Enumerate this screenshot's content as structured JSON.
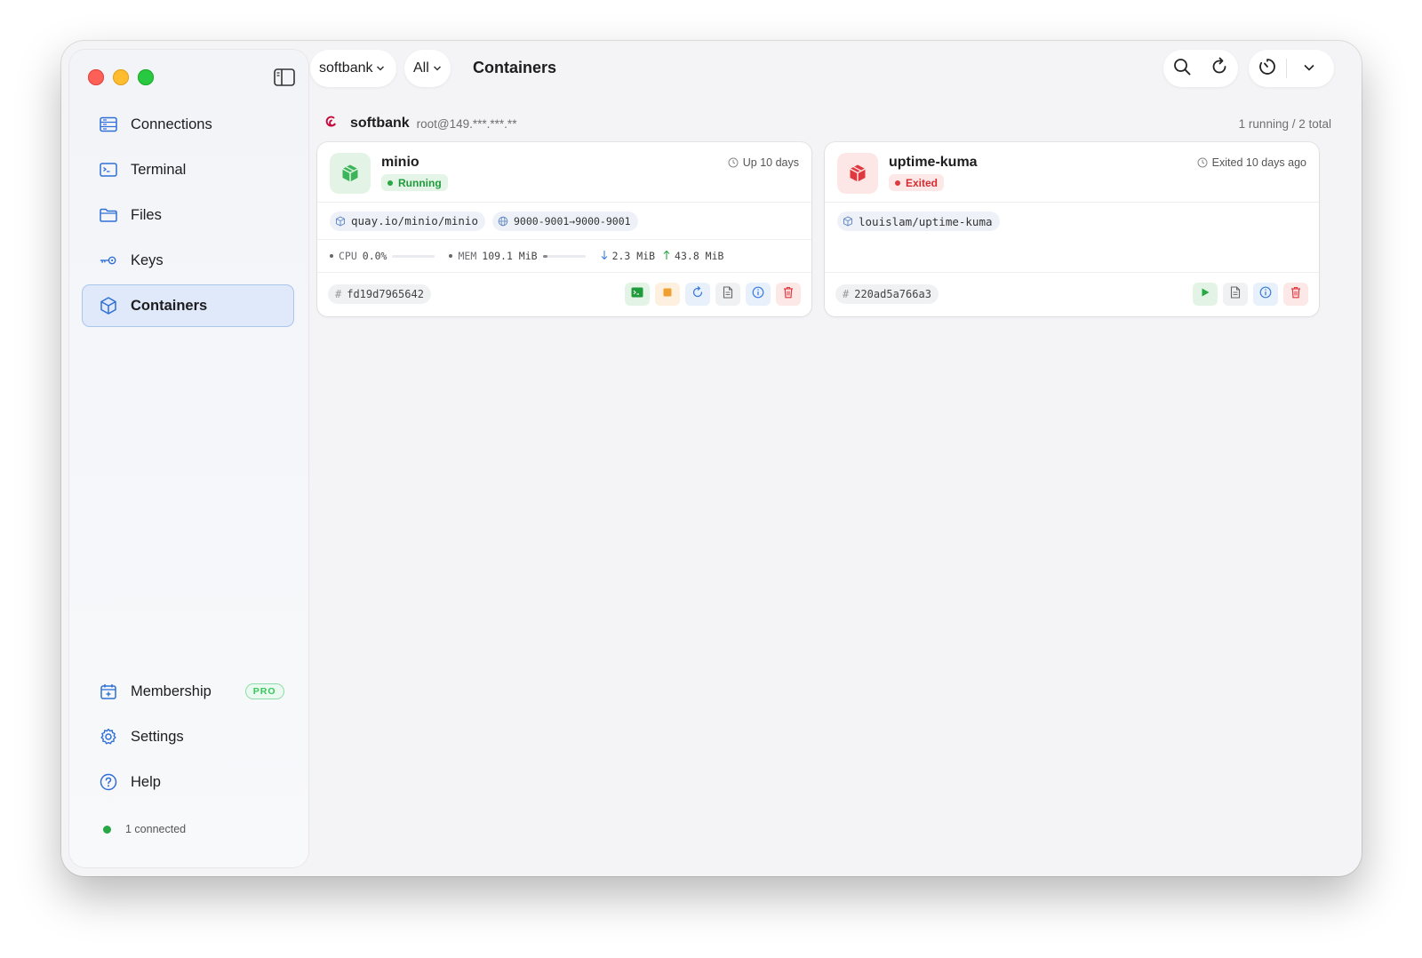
{
  "sidebar": {
    "items": [
      {
        "label": "Connections",
        "icon": "server-icon"
      },
      {
        "label": "Terminal",
        "icon": "terminal-icon"
      },
      {
        "label": "Files",
        "icon": "folder-icon"
      },
      {
        "label": "Keys",
        "icon": "key-icon"
      },
      {
        "label": "Containers",
        "icon": "cube-icon",
        "active": true
      }
    ],
    "bottom_items": [
      {
        "label": "Membership",
        "icon": "membership-icon",
        "badge": "PRO"
      },
      {
        "label": "Settings",
        "icon": "gear-icon"
      },
      {
        "label": "Help",
        "icon": "help-icon"
      }
    ],
    "status": "1 connected"
  },
  "toolbar": {
    "host_selector": "softbank",
    "filter_selector": "All",
    "title": "Containers"
  },
  "host": {
    "name": "softbank",
    "address": "root@149.***.***.**",
    "summary": "1 running / 2 total"
  },
  "containers": [
    {
      "name": "minio",
      "state": "Running",
      "uptime": "Up 10 days",
      "image": "quay.io/minio/minio",
      "ports": "9000-9001→9000-9001",
      "stats": {
        "cpu_label": "CPU",
        "cpu": "0.0%",
        "mem_label": "MEM",
        "mem": "109.1 MiB",
        "net_down": "2.3 MiB",
        "net_up": "43.8 MiB"
      },
      "id": "fd19d7965642"
    },
    {
      "name": "uptime-kuma",
      "state": "Exited",
      "uptime": "Exited 10 days ago",
      "image": "louislam/uptime-kuma",
      "id": "220ad5a766a3"
    }
  ],
  "colors": {
    "accent": "#2f6fd6",
    "running": "#28a745",
    "exited": "#e0383e"
  }
}
